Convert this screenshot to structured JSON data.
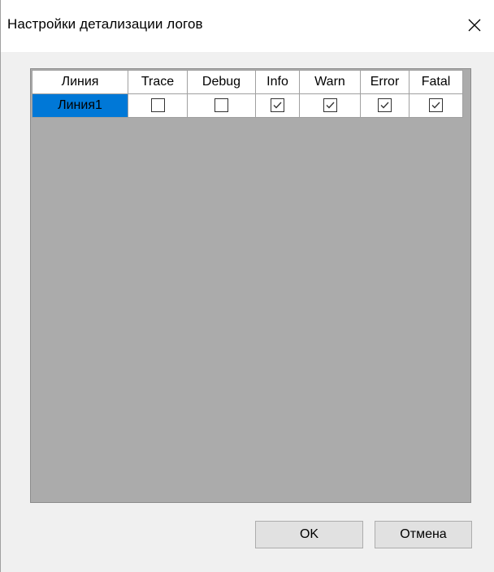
{
  "window": {
    "title": "Настройки детализации логов",
    "close_icon": "close-icon"
  },
  "grid": {
    "columns": [
      "Линия",
      "Trace",
      "Debug",
      "Info",
      "Warn",
      "Error",
      "Fatal"
    ],
    "rows": [
      {
        "name": "Линия1",
        "selected": true,
        "levels": {
          "Trace": false,
          "Debug": false,
          "Info": true,
          "Warn": true,
          "Error": true,
          "Fatal": true
        }
      }
    ]
  },
  "buttons": {
    "ok_label": "OK",
    "cancel_label": "Отмена"
  },
  "colors": {
    "selection": "#0078d7",
    "grid_background": "#ababab",
    "window_background": "#f0f0f0"
  }
}
